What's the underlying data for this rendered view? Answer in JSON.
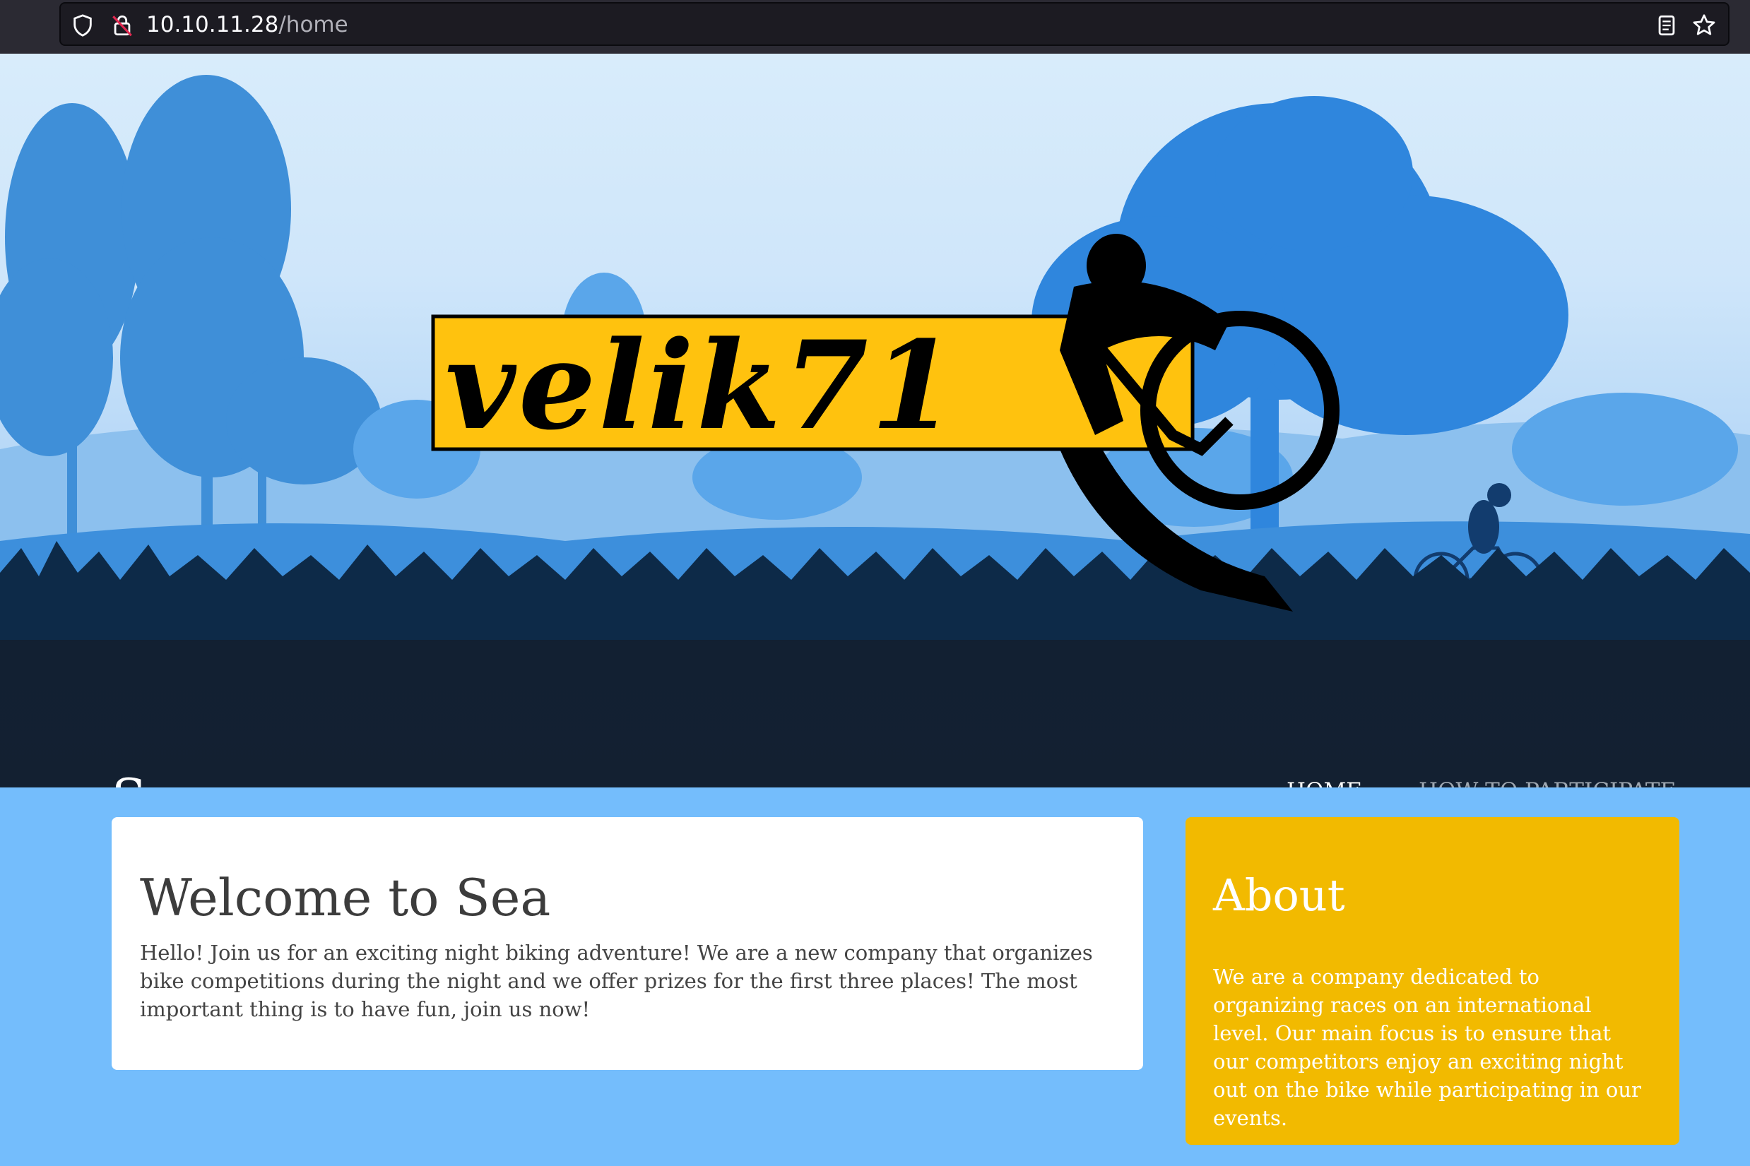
{
  "browser": {
    "url_host": "10.10.11.28",
    "url_path": "/home"
  },
  "hero": {
    "logo_text": "velik71"
  },
  "site": {
    "title": "Sea"
  },
  "nav": {
    "home": "HOME",
    "participate": "HOW TO PARTICIPATE"
  },
  "welcome": {
    "title": "Welcome to Sea",
    "text": "Hello! Join us for an exciting night biking adventure! We are a new company that organizes bike competitions during the night and we offer prizes for the first three places! The most important thing is to have fun, join us now!"
  },
  "about": {
    "title": "About",
    "text": "We are a company dedicated to organizing races on an international level. Our main focus is to ensure that our competitors enjoy an exciting night out on the bike while participating in our events."
  },
  "colors": {
    "page_background": "#74bdfc",
    "header_dark": "#132031",
    "about_yellow": "#f2ba00",
    "logo_yellow": "#ffc20e"
  }
}
